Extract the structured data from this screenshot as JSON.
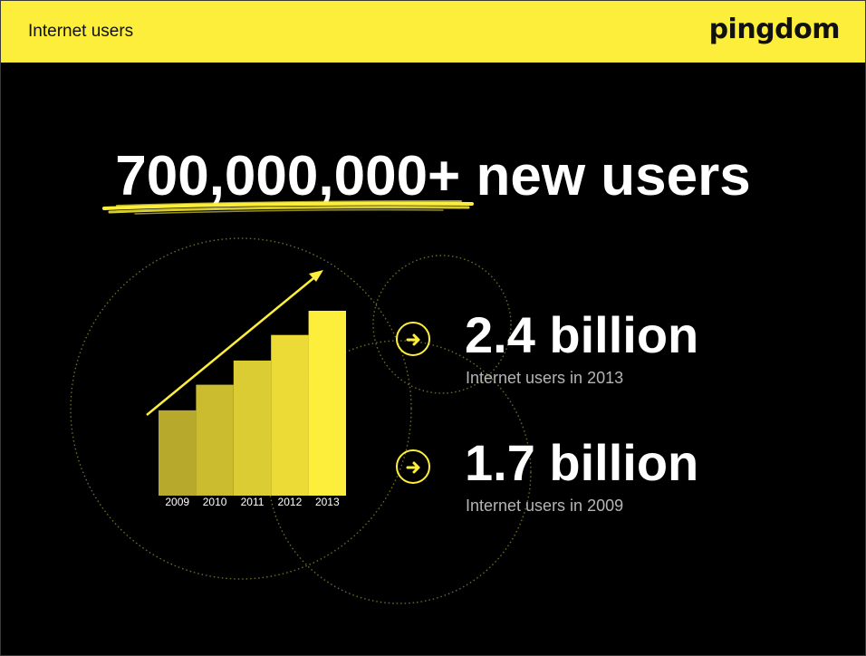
{
  "header": {
    "title": "Internet users",
    "logo": "pingdom"
  },
  "headline": "700,000,000+ new users",
  "stats": [
    {
      "value": "2.4 billion",
      "caption": "Internet users in 2013"
    },
    {
      "value": "1.7 billion",
      "caption": "Internet users in 2009"
    }
  ],
  "icons": {
    "stat_arrow": "arrow-right-circle-icon"
  },
  "colors": {
    "accent": "#fcee3a",
    "background": "#000000",
    "bar_shades": [
      "#b6a92c",
      "#cbbc2f",
      "#dccc34",
      "#ecdb37",
      "#fcee3a"
    ]
  },
  "chart_data": {
    "type": "bar",
    "categories": [
      "2009",
      "2010",
      "2011",
      "2012",
      "2013"
    ],
    "values": [
      1.7,
      1.88,
      2.05,
      2.23,
      2.4
    ],
    "title": "",
    "xlabel": "",
    "ylabel": "",
    "ylim": [
      1.1,
      2.4
    ],
    "grid": false,
    "trend_arrow": true
  }
}
